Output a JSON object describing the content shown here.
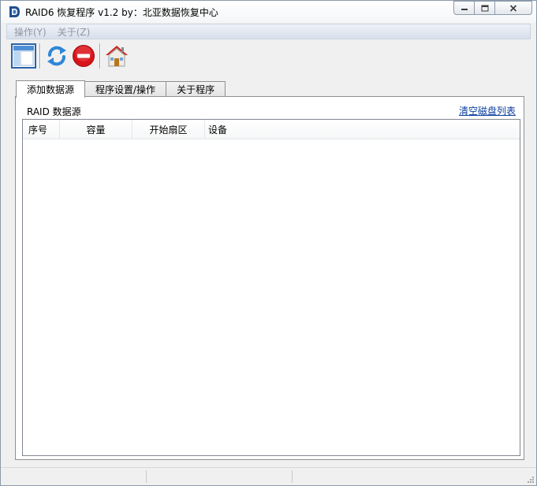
{
  "window": {
    "title": "RAID6 恢复程序 v1.2 by：北亚数据恢复中心"
  },
  "menu": {
    "items": [
      {
        "label": "操作(Y)"
      },
      {
        "label": "关于(Z)"
      }
    ]
  },
  "toolbar": {
    "buttons": [
      {
        "icon": "layout-window-icon"
      },
      {
        "icon": "refresh-icon"
      },
      {
        "icon": "stop-icon"
      },
      {
        "icon": "home-icon"
      }
    ]
  },
  "tabs": [
    {
      "label": "添加数据源",
      "active": true
    },
    {
      "label": "程序设置/操作",
      "active": false
    },
    {
      "label": "关于程序",
      "active": false
    }
  ],
  "panel": {
    "source_label": "RAID 数据源",
    "clear_link": "清空磁盘列表"
  },
  "list": {
    "columns": [
      "序号",
      "容量",
      "开始扇区",
      "设备"
    ],
    "rows": []
  },
  "colors": {
    "link": "#0b3f9e",
    "menu_text_disabled": "#8f97a3",
    "stop_red": "#d7141a",
    "refresh_blue": "#2f86d6",
    "home_red": "#c8281e"
  }
}
